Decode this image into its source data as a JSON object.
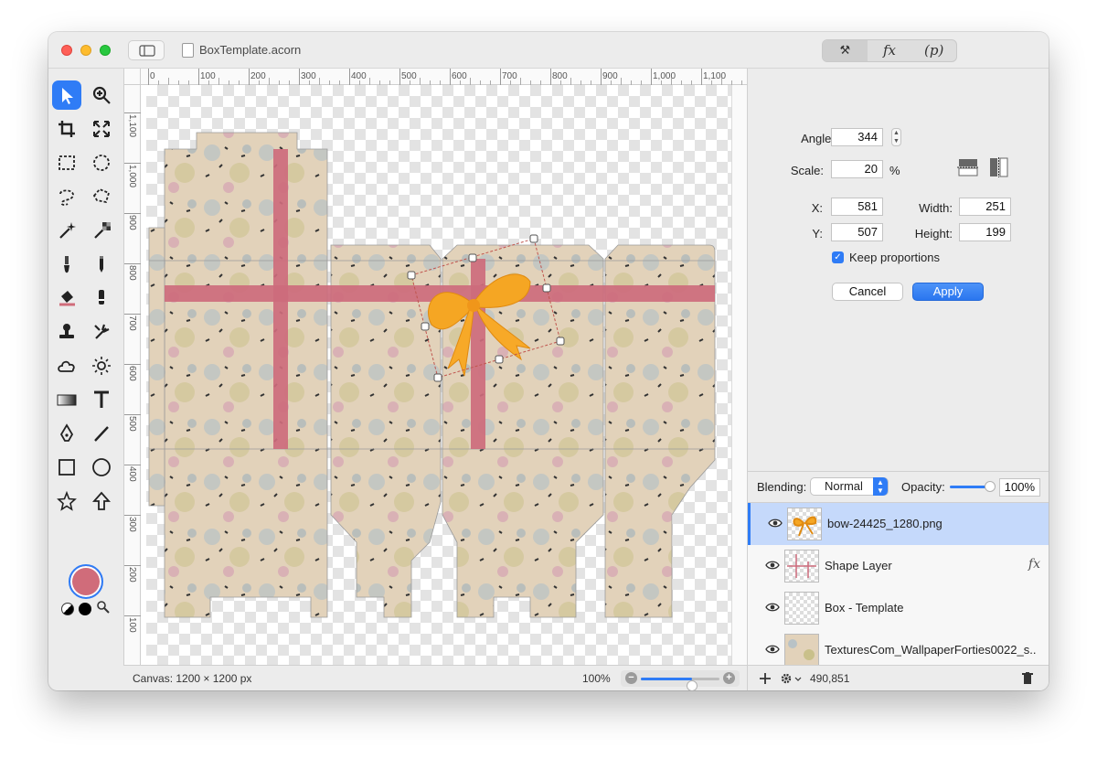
{
  "window": {
    "title": "BoxTemplate.acorn"
  },
  "inspector_tabs": {
    "tools": "⚒",
    "fx": "fx",
    "p": "(p)"
  },
  "transform": {
    "angle_label": "Angle:",
    "angle_value": "344",
    "scale_label": "Scale:",
    "scale_value": "20",
    "scale_unit": "%",
    "x_label": "X:",
    "x_value": "581",
    "y_label": "Y:",
    "y_value": "507",
    "width_label": "Width:",
    "width_value": "251",
    "height_label": "Height:",
    "height_value": "199",
    "keep_proportions": "Keep proportions",
    "keep_proportions_checked": true,
    "cancel": "Cancel",
    "apply": "Apply"
  },
  "layers_panel": {
    "blending_label": "Blending:",
    "blending_value": "Normal",
    "opacity_label": "Opacity:",
    "opacity_value": "100%",
    "opacity_fraction": 1.0,
    "layers": [
      {
        "name": "bow-24425_1280.png",
        "selected": true,
        "fx": false
      },
      {
        "name": "Shape Layer",
        "selected": false,
        "fx": true,
        "fx_label": "fx"
      },
      {
        "name": "Box - Template",
        "selected": false,
        "fx": false
      },
      {
        "name": "TexturesCom_WallpaperForties0022_s...",
        "selected": false,
        "fx": false
      }
    ]
  },
  "status": {
    "canvas_size": "Canvas: 1200 × 1200 px",
    "zoom": "100%",
    "zoom_fraction": 0.65,
    "coordinates": "490,851"
  },
  "rulers": {
    "top": [
      "0",
      "100",
      "200",
      "300",
      "400",
      "500",
      "600",
      "700",
      "800",
      "900",
      "1,000",
      "1,100"
    ],
    "left": [
      "1,100",
      "1,000",
      "900",
      "800",
      "700",
      "600",
      "500",
      "400",
      "300",
      "200",
      "100"
    ]
  },
  "colors": {
    "foreground": "#d06c7a",
    "accent": "#2f7cf6",
    "ribbon": "#cd6b7c",
    "bow": "#f5a623"
  },
  "tools": [
    "arrow-select-icon",
    "zoom-icon",
    "crop-icon",
    "resize-icon",
    "rect-select-icon",
    "ellipse-select-icon",
    "lasso-icon",
    "polygon-lasso-icon",
    "magic-wand-icon",
    "instant-alpha-icon",
    "brush-icon",
    "pencil-icon",
    "paint-bucket-icon",
    "smudge-icon",
    "clone-stamp-icon",
    "retouch-icon",
    "cloud-icon",
    "sun-icon",
    "gradient-icon",
    "text-icon",
    "pen-icon",
    "line-icon",
    "rectangle-icon",
    "circle-icon",
    "star-icon",
    "arrow-up-icon"
  ]
}
